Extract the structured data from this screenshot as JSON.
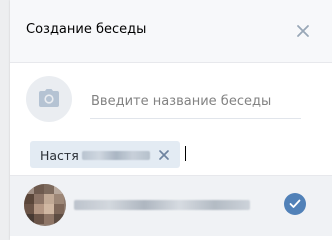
{
  "dialog": {
    "title": "Создание беседы",
    "close_icon": "close-icon"
  },
  "chat_photo": {
    "icon": "camera-icon"
  },
  "chat_name": {
    "placeholder": "Введите название беседы",
    "value": ""
  },
  "selected_members": [
    {
      "first_name": "Настя",
      "remove_icon": "close-icon"
    }
  ],
  "friends_list": [
    {
      "selected": true,
      "check_icon": "checkmark-icon"
    }
  ],
  "colors": {
    "header_bg": "#f7f8fa",
    "accent": "#5181b8",
    "token_bg": "#e3ebf3",
    "icon_gray": "#b5c3d3",
    "row_hover_bg": "#f0f2f5"
  }
}
